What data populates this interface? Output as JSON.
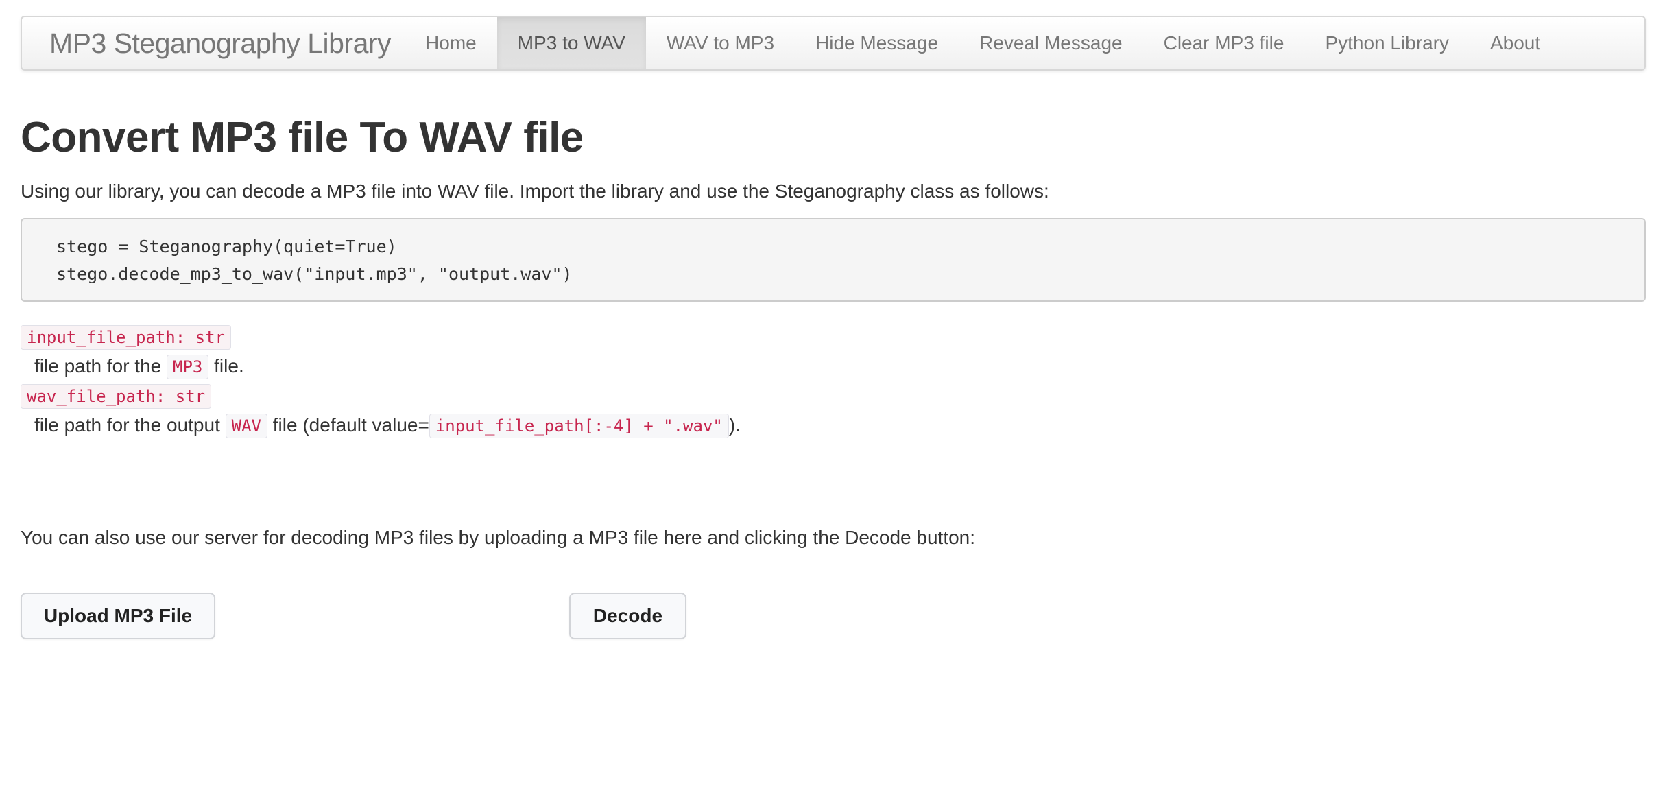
{
  "navbar": {
    "brand": "MP3 Steganography Library",
    "items": [
      {
        "label": "Home",
        "active": false
      },
      {
        "label": "MP3 to WAV",
        "active": true
      },
      {
        "label": "WAV to MP3",
        "active": false
      },
      {
        "label": "Hide Message",
        "active": false
      },
      {
        "label": "Reveal Message",
        "active": false
      },
      {
        "label": "Clear MP3 file",
        "active": false
      },
      {
        "label": "Python Library",
        "active": false
      },
      {
        "label": "About",
        "active": false
      }
    ]
  },
  "main": {
    "title": "Convert MP3 file To WAV file",
    "intro": "Using our library, you can decode a MP3 file into WAV file. Import the library and use the Steganography class as follows:",
    "code_lines": [
      "stego = Steganography(quiet=True)",
      "stego.decode_mp3_to_wav(\"input.mp3\", \"output.wav\")"
    ],
    "params": [
      {
        "name": "input_file_path: str",
        "desc_prefix": "file path for the ",
        "desc_code": "MP3",
        "desc_suffix": " file."
      },
      {
        "name": "wav_file_path: str",
        "desc_prefix": "file path for the output ",
        "desc_code": "WAV",
        "desc_middle": " file (default value=",
        "desc_code2": "input_file_path[:-4] + \".wav\"",
        "desc_suffix": ")."
      }
    ],
    "server_text": "You can also use our server for decoding MP3 files by uploading a MP3 file here and clicking the Decode button:",
    "upload_button": "Upload MP3 File",
    "decode_button": "Decode"
  },
  "colors": {
    "code_text": "#c7254e",
    "nav_active_bg": "#e0e0e0",
    "brand_text": "#777777"
  }
}
